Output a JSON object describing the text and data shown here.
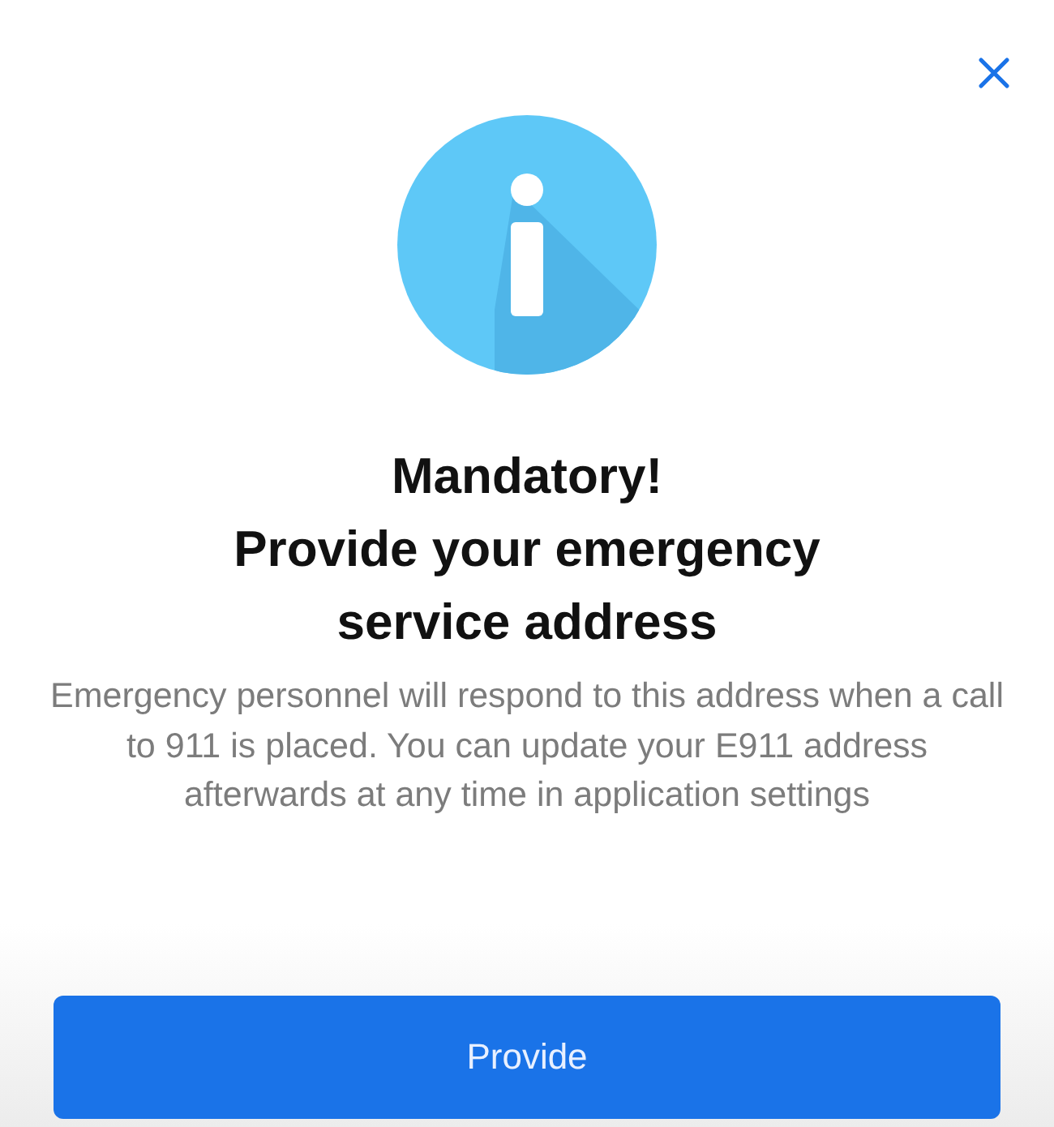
{
  "dialog": {
    "heading": "Mandatory!",
    "title": "Provide your emergency service address",
    "message": "Emergency personnel will respond to this address when a call to 911 is placed. You can update your E911 address afterwards at any time in application settings",
    "buttons": [
      {
        "label": "Provide",
        "kind": "primary"
      }
    ]
  }
}
